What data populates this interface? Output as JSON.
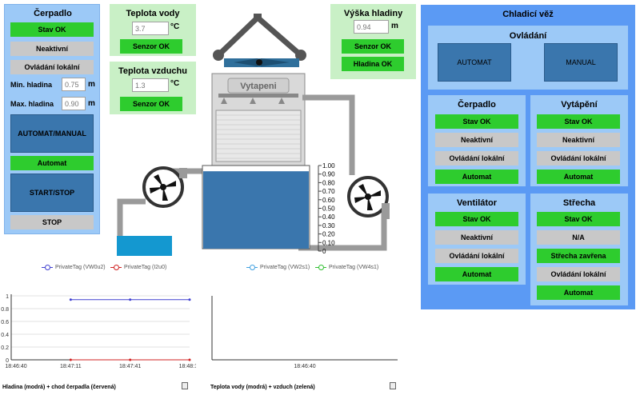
{
  "pump": {
    "title": "Čerpadlo",
    "stav": "Stav OK",
    "neaktivni": "Neaktivní",
    "ovladani": "Ovládání lokální",
    "min_label": "Min. hladina",
    "min_value": "0.75",
    "max_label": "Max. hladina",
    "max_value": "0.90",
    "unit": "m",
    "auto_manual": "AUTOMAT/MANUAL",
    "automat": "Automat",
    "start_stop": "START/STOP",
    "stop": "STOP"
  },
  "water_temp": {
    "title": "Teplota vody",
    "value": "3.7",
    "unit": "°C",
    "sensor": "Senzor OK"
  },
  "air_temp": {
    "title": "Teplota vzduchu",
    "value": "1.3",
    "unit": "°C",
    "sensor": "Senzor OK"
  },
  "level": {
    "title": "Výška hladiny",
    "value": "0.94",
    "unit": "m",
    "sensor": "Senzor OK",
    "status": "Hladina OK"
  },
  "diagram": {
    "heater_label": "Vytapeni",
    "scale": [
      "1.00",
      "0.90",
      "0.80",
      "0.70",
      "0.60",
      "0.50",
      "0.40",
      "0.30",
      "0.20",
      "0.10",
      "0"
    ],
    "tank_level": 0.94,
    "basin_level": 0.3
  },
  "tower": {
    "title": "Chladicí věž",
    "control": {
      "title": "Ovládání",
      "automat": "AUTOMAT",
      "manual": "MANUAL"
    },
    "pump": {
      "title": "Čerpadlo",
      "items": [
        "Stav OK",
        "Neaktivní",
        "Ovládání lokální",
        "Automat"
      ]
    },
    "heating": {
      "title": "Vytápění",
      "items": [
        "Stav OK",
        "Neaktivní",
        "Ovládání lokální",
        "Automat"
      ]
    },
    "fan": {
      "title": "Ventilátor",
      "items": [
        "Stav OK",
        "Neaktivní",
        "Ovládání lokální",
        "Automat"
      ]
    },
    "roof": {
      "title": "Střecha",
      "items": [
        "Stav OK",
        "N/A",
        "Střecha zavřena",
        "Ovládání lokální",
        "Automat"
      ]
    }
  },
  "chart_left": {
    "legend": [
      "PrivateTag (VW0u2)",
      "PrivateTag (I2u0)"
    ],
    "caption": "Hladina (modrá) + chod čerpadla (červená)"
  },
  "chart_right": {
    "legend": [
      "PrivateTag (VW2s1)",
      "PrivateTag (VW4s1)"
    ],
    "caption": "Teplota vody (modrá) + vzduch (zelená)"
  },
  "chart_data": [
    {
      "type": "line",
      "x": [
        "18:46:40",
        "18:47:11",
        "18:47:41",
        "18:48:11"
      ],
      "series": [
        {
          "name": "PrivateTag (VW0u2)",
          "color": "#4040d0",
          "x": [
            "18:47:11",
            "18:47:41",
            "18:48:11"
          ],
          "values": [
            0.94,
            0.94,
            0.94
          ]
        },
        {
          "name": "PrivateTag (I2u0)",
          "color": "#d02020",
          "x": [
            "18:47:11",
            "18:47:41",
            "18:48:11"
          ],
          "values": [
            0,
            0,
            0
          ]
        }
      ],
      "yticks": [
        "0",
        "0.2",
        "0.4",
        "0.6",
        "0.8",
        "1"
      ],
      "ylim": [
        0,
        1
      ],
      "grid": true
    },
    {
      "type": "line",
      "x": [
        "18:46:40"
      ],
      "series": [
        {
          "name": "PrivateTag (VW2s1)",
          "color": "#40a0e0",
          "values": []
        },
        {
          "name": "PrivateTag (VW4s1)",
          "color": "#30c030",
          "values": []
        }
      ],
      "grid": false
    }
  ]
}
